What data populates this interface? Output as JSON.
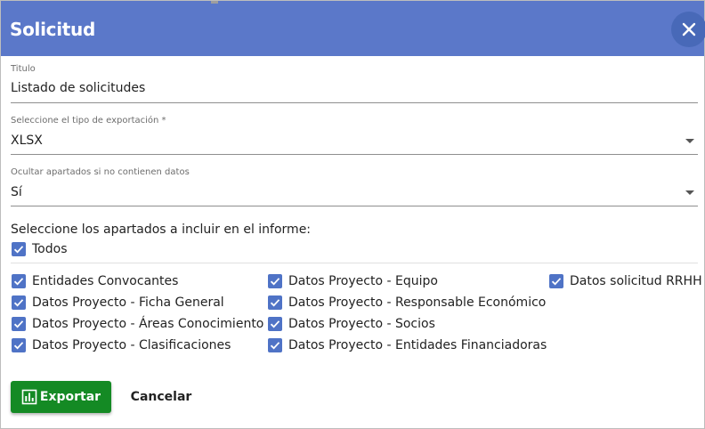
{
  "dialog": {
    "title": "Solicitud"
  },
  "fields": {
    "titulo": {
      "label": "Titulo",
      "value": "Listado de solicitudes"
    },
    "tipo": {
      "label": "Seleccione el tipo de exportación *",
      "value": "XLSX"
    },
    "ocultar": {
      "label": "Ocultar apartados si no contienen datos",
      "value": "Sí"
    }
  },
  "sections": {
    "prompt": "Seleccione los apartados a incluir en el informe:",
    "all": {
      "label": "Todos",
      "checked": true
    },
    "items": [
      {
        "label": "Entidades Convocantes",
        "checked": true
      },
      {
        "label": "Datos Proyecto - Equipo",
        "checked": true
      },
      {
        "label": "Datos solicitud RRHH",
        "checked": true
      },
      {
        "label": "Datos Proyecto - Ficha General",
        "checked": true
      },
      {
        "label": "Datos Proyecto - Responsable Económico",
        "checked": true
      },
      {
        "label": "Datos Proyecto - Áreas Conocimiento",
        "checked": true
      },
      {
        "label": "Datos Proyecto - Socios",
        "checked": true
      },
      {
        "label": "Datos Proyecto - Clasificaciones",
        "checked": true
      },
      {
        "label": "Datos Proyecto - Entidades Financiadoras",
        "checked": true
      }
    ]
  },
  "actions": {
    "export_label": "Exportar",
    "cancel_label": "Cancelar"
  },
  "colors": {
    "header": "#5b78c9",
    "checkbox": "#4f73c6",
    "export_button": "#148a24"
  }
}
